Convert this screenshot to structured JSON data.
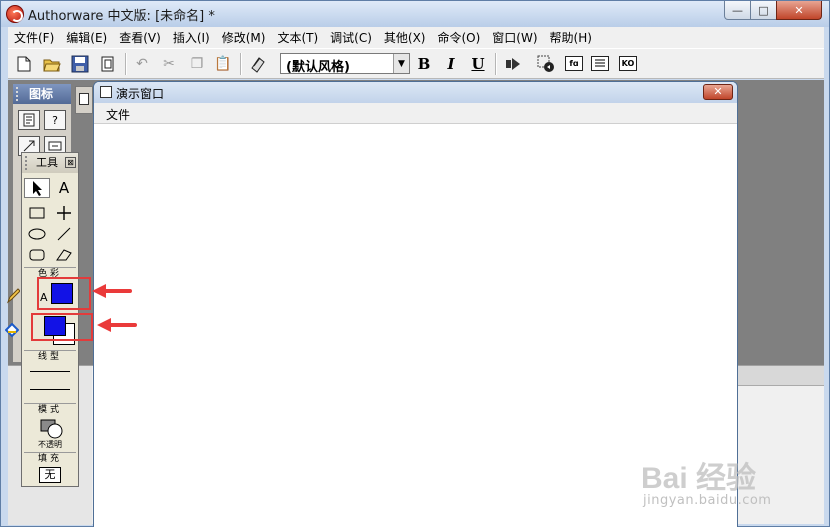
{
  "app": {
    "title": "Authorware 中文版: [未命名] *",
    "window_controls": {
      "minimize": "—",
      "maximize": "□",
      "close": "✕"
    }
  },
  "menubar": {
    "items": [
      "文件(F)",
      "编辑(E)",
      "查看(V)",
      "插入(I)",
      "修改(M)",
      "文本(T)",
      "调试(C)",
      "其他(X)",
      "命令(O)",
      "窗口(W)",
      "帮助(H)"
    ]
  },
  "toolbar": {
    "style_select_value": "(默认风格)",
    "bold": "B",
    "italic": "I",
    "underline": "U",
    "box_icon_1": "fɑ",
    "box_icon_2": "",
    "box_icon_3": "KO"
  },
  "icon_palette": {
    "title": "图标"
  },
  "tools_palette": {
    "title": "工具",
    "text_tool": "A",
    "color_section": "色彩",
    "line_section": "线型",
    "mode_section": "模式",
    "mode_value": "不透明",
    "fill_section": "填充",
    "fill_value": "无",
    "text_color_label": "A",
    "colors": {
      "swatch": "#1212e6",
      "highlight": "#e33b3b"
    }
  },
  "presentation_window": {
    "title": "演示窗口",
    "menu": "文件"
  },
  "watermark": {
    "logo": "Bai 经验",
    "url": "jingyan.baidu.com"
  }
}
